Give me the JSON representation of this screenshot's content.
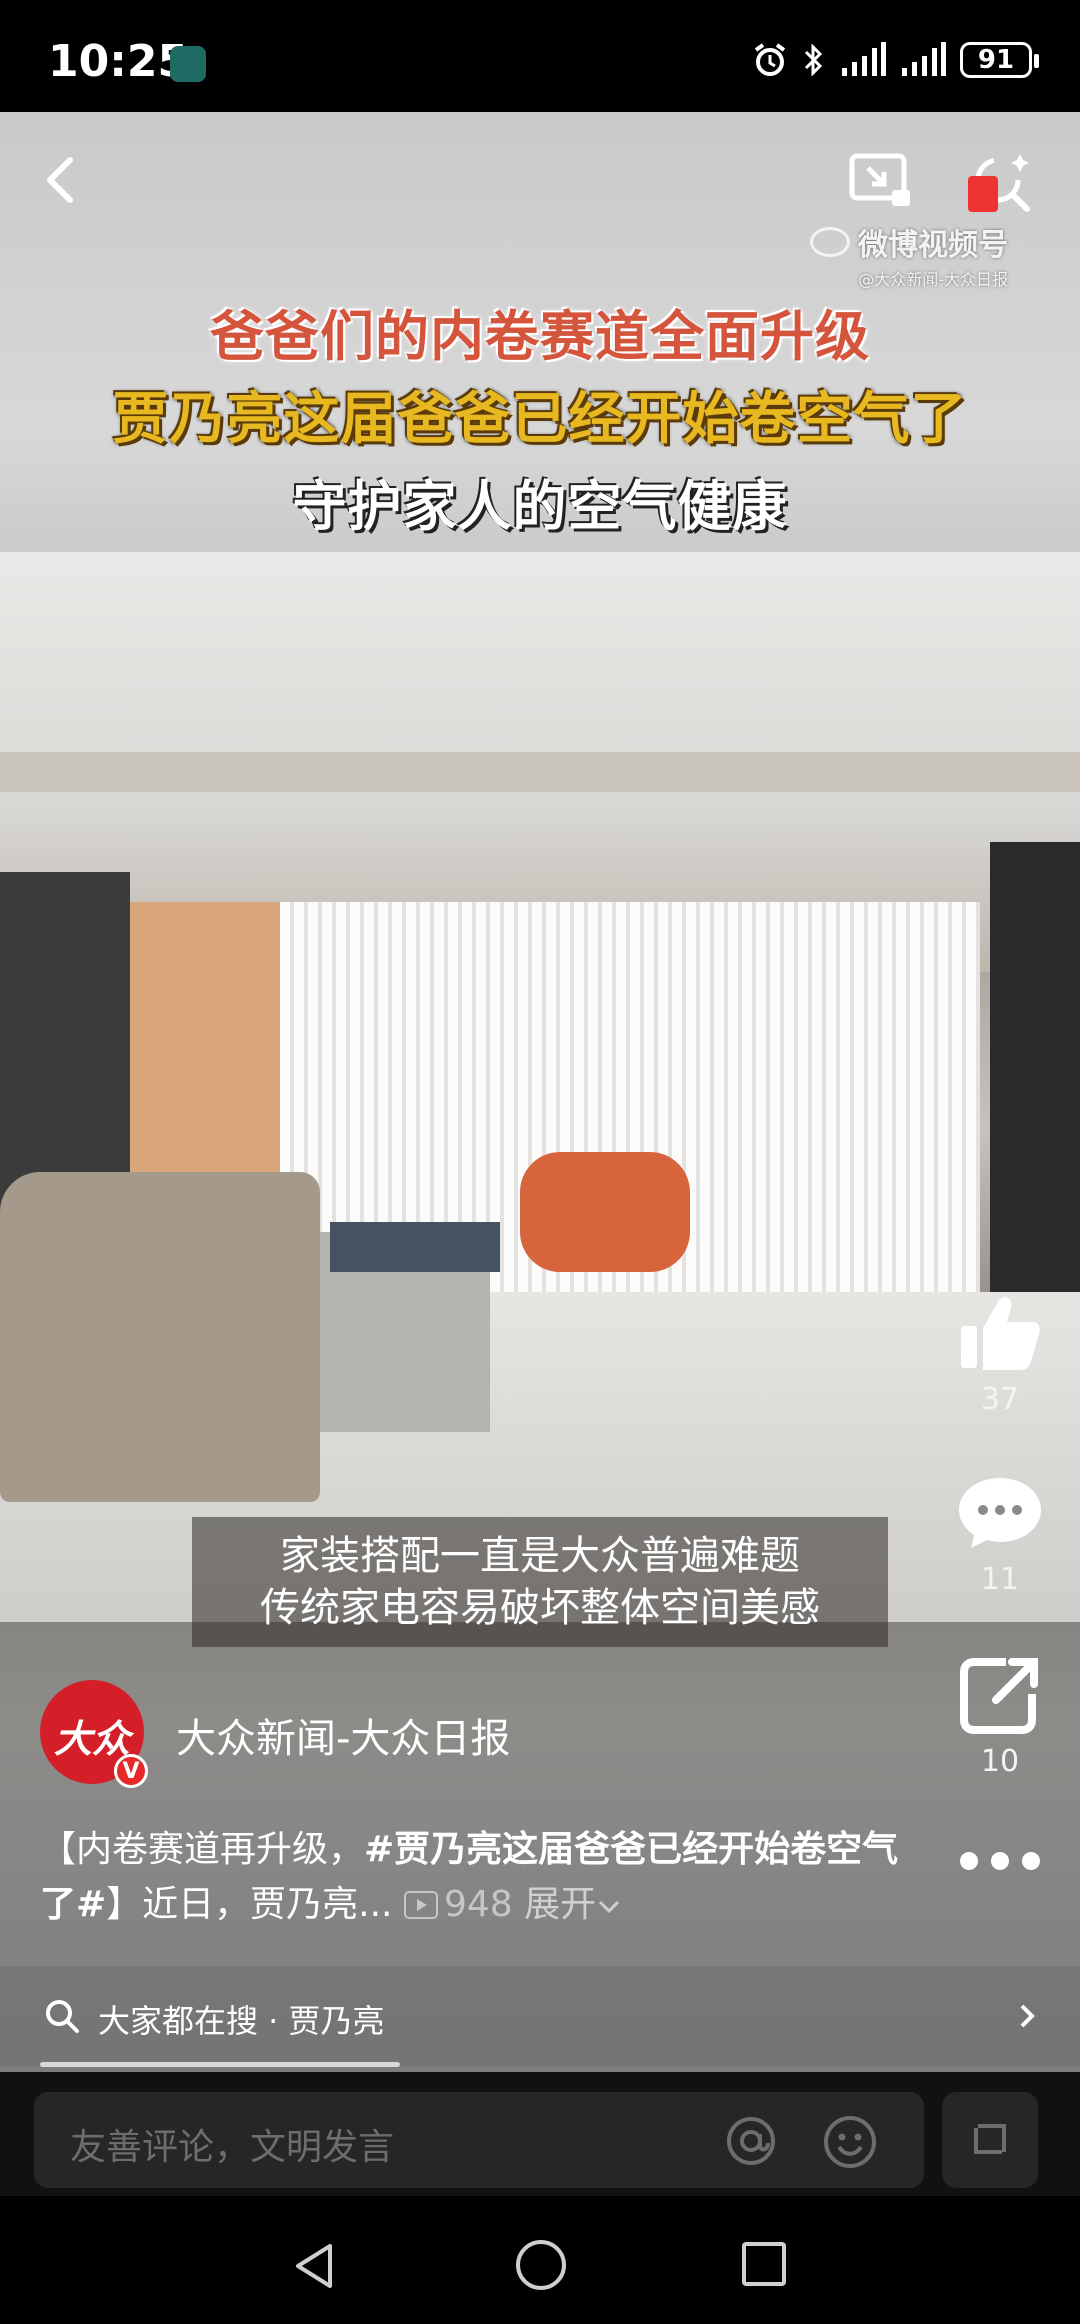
{
  "status_bar": {
    "time": "10:25",
    "battery": "91",
    "icons": [
      "alarm-icon",
      "bluetooth-icon",
      "signal-icon",
      "signal-icon"
    ]
  },
  "video": {
    "title_lines": [
      "爸爸们的内卷赛道全面升级",
      "贾乃亮这届爸爸已经开始卷空气了",
      "守护家人的空气健康"
    ],
    "watermark": {
      "main": "微博视频号",
      "sub": "@大众新闻-大众日报"
    },
    "subtitle_lines": [
      "家装搭配一直是大众普遍难题",
      "传统家电容易破坏整体空间美感"
    ],
    "colors": {
      "title_red": "#d4543c",
      "title_yellow": "#e8b820",
      "chair": "#d8643d"
    }
  },
  "actions": {
    "like_count": "37",
    "comment_count": "11",
    "share_count": "10"
  },
  "account": {
    "avatar_text": "大众",
    "verified_badge": "V",
    "name": "大众新闻-大众日报"
  },
  "caption": {
    "prefix": "【内卷赛道再升级，",
    "hashtag": "#贾乃亮这届爸爸已经开始卷空气了#",
    "suffix": "】近日，贾乃亮...",
    "views": "948",
    "expand": "展开"
  },
  "search_strip": {
    "text": "大家都在搜 · 贾乃亮",
    "progress": 0.36
  },
  "comment_bar": {
    "placeholder": "友善评论，文明发言"
  }
}
